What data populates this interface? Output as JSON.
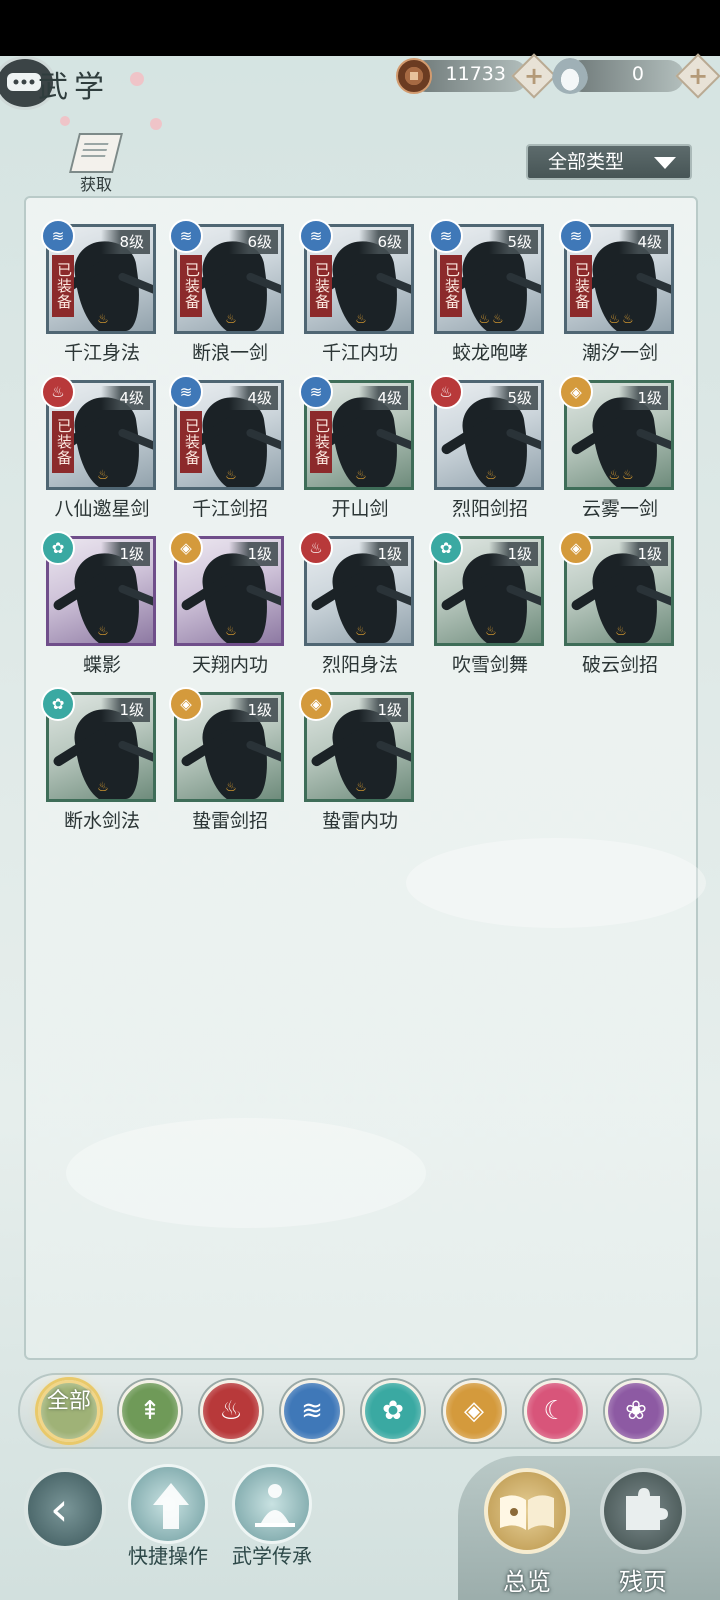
{
  "header": {
    "title": "武学",
    "copper": "11733",
    "silver": "0",
    "plus": "+"
  },
  "toolbar": {
    "acquire_label": "获取",
    "filter_label": "全部类型"
  },
  "skills": [
    {
      "name": "千江身法",
      "level": "8级",
      "equipped": "已装备",
      "school": "wave",
      "flames": "♨"
    },
    {
      "name": "断浪一剑",
      "level": "6级",
      "equipped": "已装备",
      "school": "wave",
      "flames": "♨"
    },
    {
      "name": "千江内功",
      "level": "6级",
      "equipped": "已装备",
      "school": "wave",
      "flames": "♨"
    },
    {
      "name": "蛟龙咆哮",
      "level": "5级",
      "equipped": "已装备",
      "school": "wave",
      "flames": "♨♨"
    },
    {
      "name": "潮汐一剑",
      "level": "4级",
      "equipped": "已装备",
      "school": "wave",
      "flames": "♨♨"
    },
    {
      "name": "八仙邀星剑",
      "level": "4级",
      "equipped": "已装备",
      "school": "flame",
      "flames": "♨"
    },
    {
      "name": "千江剑招",
      "level": "4级",
      "equipped": "已装备",
      "school": "wave",
      "flames": "♨"
    },
    {
      "name": "开山剑",
      "level": "4级",
      "equipped": "已装备",
      "school": "wave",
      "flames": "♨"
    },
    {
      "name": "烈阳剑招",
      "level": "5级",
      "equipped": "",
      "school": "flame",
      "flames": "♨"
    },
    {
      "name": "云雾一剑",
      "level": "1级",
      "equipped": "",
      "school": "shield",
      "flames": "♨♨"
    },
    {
      "name": "蝶影",
      "level": "1级",
      "equipped": "",
      "school": "butterfly",
      "flames": "♨"
    },
    {
      "name": "天翔内功",
      "level": "1级",
      "equipped": "",
      "school": "shield",
      "flames": "♨"
    },
    {
      "name": "烈阳身法",
      "level": "1级",
      "equipped": "",
      "school": "flame",
      "flames": "♨"
    },
    {
      "name": "吹雪剑舞",
      "level": "1级",
      "equipped": "",
      "school": "butterfly",
      "flames": "♨"
    },
    {
      "name": "破云剑招",
      "level": "1级",
      "equipped": "",
      "school": "shield",
      "flames": "♨"
    },
    {
      "name": "断水剑法",
      "level": "1级",
      "equipped": "",
      "school": "butterfly",
      "flames": "♨"
    },
    {
      "name": "蛰雷剑招",
      "level": "1级",
      "equipped": "",
      "school": "shield",
      "flames": "♨"
    },
    {
      "name": "蛰雷内功",
      "level": "1级",
      "equipped": "",
      "school": "shield",
      "flames": "♨"
    }
  ],
  "school_colors": {
    "wave": "#3f78b8",
    "flame": "#b8393a",
    "shield": "#d49a3c",
    "butterfly": "#3aa9a2",
    "feather": "#5f9a4b",
    "moon": "#d8557a",
    "rose": "#8d5aa3"
  },
  "school_tabs": [
    {
      "label": "全部",
      "color": "#9fb277",
      "icon": "all-icon"
    },
    {
      "label": "",
      "color": "#6f9a58",
      "icon": "feather-icon"
    },
    {
      "label": "",
      "color": "#b8393a",
      "icon": "flame-icon"
    },
    {
      "label": "",
      "color": "#3f78b8",
      "icon": "wave-icon"
    },
    {
      "label": "",
      "color": "#3aa9a2",
      "icon": "butterfly-icon"
    },
    {
      "label": "",
      "color": "#d49a3c",
      "icon": "shield-icon"
    },
    {
      "label": "",
      "color": "#d8557a",
      "icon": "moon-icon"
    },
    {
      "label": "",
      "color": "#8d5aa3",
      "icon": "rose-icon"
    }
  ],
  "bottom_nav": {
    "quick_ops": "快捷操作",
    "inheritance": "武学传承",
    "overview": "总览",
    "fragments": "残页"
  }
}
